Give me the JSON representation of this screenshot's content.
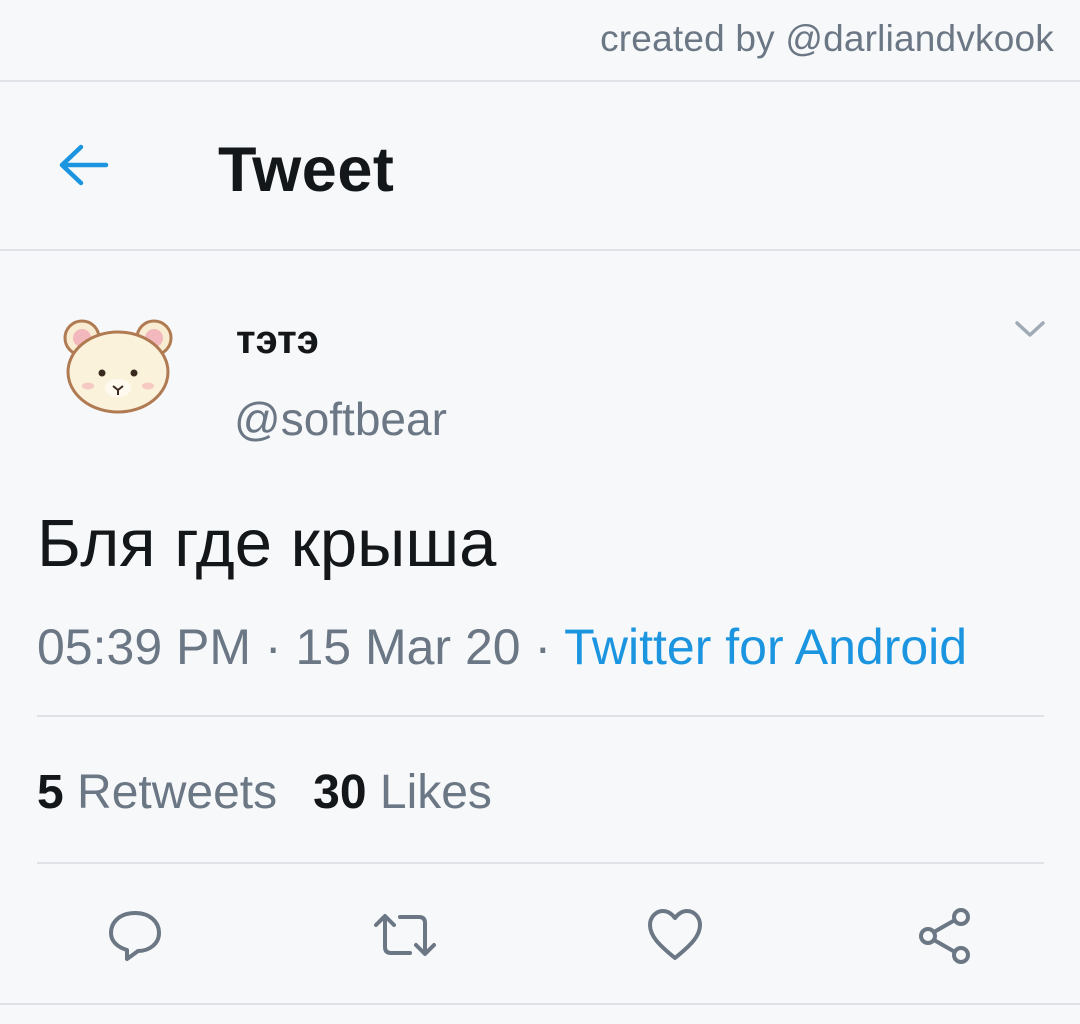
{
  "credit": "created by @darliandvkook",
  "header": {
    "back_icon": "arrow-left-icon",
    "title": "Tweet"
  },
  "tweet": {
    "author": {
      "display_name": "тэтэ",
      "handle": "@softbear",
      "avatar_icon": "bear-avatar"
    },
    "menu_icon": "chevron-down-icon",
    "text": "Бля где крыша",
    "time": "05:39 PM",
    "separator": " · ",
    "date": "15 Mar 20",
    "source": "Twitter for Android",
    "retweets_count": "5",
    "retweets_label": "Retweets",
    "likes_count": "30",
    "likes_label": "Likes"
  },
  "actions": {
    "reply_icon": "reply-icon",
    "retweet_icon": "retweet-icon",
    "like_icon": "heart-icon",
    "share_icon": "share-icon"
  },
  "colors": {
    "accent": "#1b95e0",
    "secondary_text": "#6b7785",
    "primary_text": "#14171a",
    "divider": "#dfe3e8",
    "background": "#f7f8f9"
  }
}
